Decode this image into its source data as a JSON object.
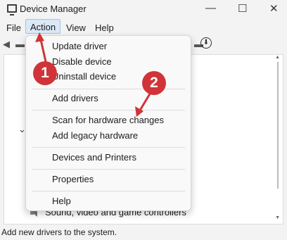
{
  "window": {
    "title": "Device Manager",
    "controls": [
      "—",
      "☐",
      "✕"
    ]
  },
  "menubar": {
    "file": "File",
    "action": "Action",
    "view": "View",
    "help": "Help"
  },
  "action_menu": {
    "items": [
      "Update driver",
      "Disable device",
      "Uninstall device",
      "Add drivers",
      "Scan for hardware changes",
      "Add legacy hardware",
      "Devices and Printers",
      "Properties",
      "Help"
    ]
  },
  "tree": {
    "sound_row": "Sound, video and game controllers"
  },
  "status": {
    "text": "Add new drivers to the system."
  },
  "annotations": {
    "step1": "1",
    "step2": "2",
    "color": "#d13438"
  }
}
